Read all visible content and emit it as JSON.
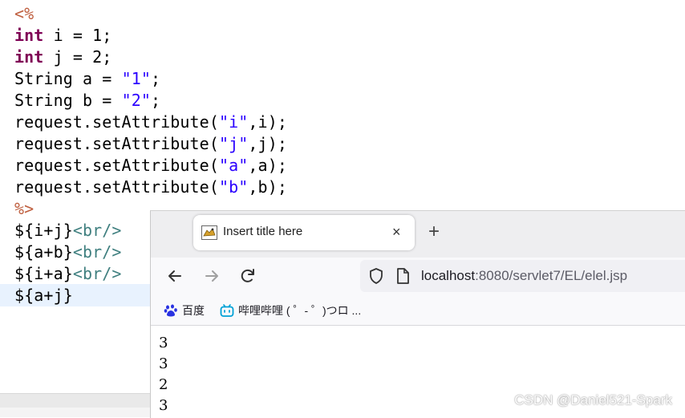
{
  "editor": {
    "lines": [
      {
        "parts": [
          {
            "t": "<%",
            "c": "jsp"
          }
        ]
      },
      {
        "parts": [
          {
            "t": "int",
            "c": "kw"
          },
          {
            "t": " i = 1;",
            "c": ""
          }
        ]
      },
      {
        "parts": [
          {
            "t": "int",
            "c": "kw"
          },
          {
            "t": " j = 2;",
            "c": ""
          }
        ]
      },
      {
        "parts": [
          {
            "t": "String a = ",
            "c": ""
          },
          {
            "t": "\"1\"",
            "c": "str"
          },
          {
            "t": ";",
            "c": ""
          }
        ]
      },
      {
        "parts": [
          {
            "t": "String b = ",
            "c": ""
          },
          {
            "t": "\"2\"",
            "c": "str"
          },
          {
            "t": ";",
            "c": ""
          }
        ]
      },
      {
        "parts": [
          {
            "t": "request.setAttribute(",
            "c": ""
          },
          {
            "t": "\"i\"",
            "c": "str"
          },
          {
            "t": ",i);",
            "c": ""
          }
        ]
      },
      {
        "parts": [
          {
            "t": "request.setAttribute(",
            "c": ""
          },
          {
            "t": "\"j\"",
            "c": "str"
          },
          {
            "t": ",j);",
            "c": ""
          }
        ]
      },
      {
        "parts": [
          {
            "t": "request.setAttribute(",
            "c": ""
          },
          {
            "t": "\"a\"",
            "c": "str"
          },
          {
            "t": ",a);",
            "c": ""
          }
        ]
      },
      {
        "parts": [
          {
            "t": "request.setAttribute(",
            "c": ""
          },
          {
            "t": "\"b\"",
            "c": "str"
          },
          {
            "t": ",b);",
            "c": ""
          }
        ]
      },
      {
        "parts": [
          {
            "t": "%>",
            "c": "jsp"
          }
        ]
      },
      {
        "parts": [
          {
            "t": "${i+j}",
            "c": ""
          },
          {
            "t": "<br/>",
            "c": "tag"
          }
        ]
      },
      {
        "parts": [
          {
            "t": "${a+b}",
            "c": ""
          },
          {
            "t": "<br/>",
            "c": "tag"
          }
        ]
      },
      {
        "parts": [
          {
            "t": "${i+a}",
            "c": ""
          },
          {
            "t": "<br/>",
            "c": "tag"
          }
        ]
      },
      {
        "parts": [
          {
            "t": "${a+j}",
            "c": ""
          }
        ]
      }
    ]
  },
  "browser": {
    "tab_title": "Insert title here",
    "tab_close": "×",
    "new_tab": "+",
    "url_host": "localhost",
    "url_rest": ":8080/servlet7/EL/elel.jsp",
    "bookmarks": [
      {
        "label": "百度",
        "icon": "baidu-paw-icon"
      },
      {
        "label": "哔哩哔哩 ( ゜- ゜)つロ ...",
        "icon": "bilibili-icon"
      }
    ],
    "output": [
      "3",
      "3",
      "2",
      "3"
    ]
  },
  "colors": {
    "keyword": "#7f0055",
    "string": "#2a00ff",
    "jsp_tag": "#bf5f3f",
    "html_tag": "#3f7f7f"
  },
  "watermark": "CSDN @Daniel521-Spark"
}
